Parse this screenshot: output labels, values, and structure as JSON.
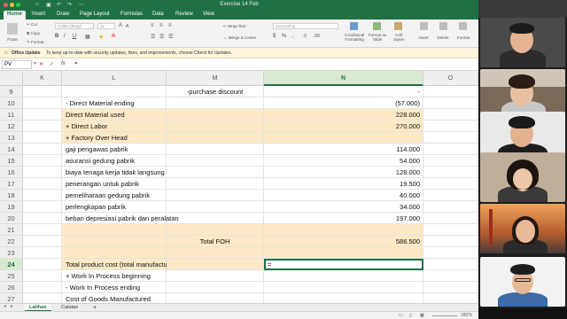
{
  "window": {
    "title": "Exercise 14 Feb"
  },
  "ribbon_tabs": [
    {
      "label": "Home",
      "active": true
    },
    {
      "label": "Insert"
    },
    {
      "label": "Draw"
    },
    {
      "label": "Page Layout"
    },
    {
      "label": "Formulas"
    },
    {
      "label": "Data"
    },
    {
      "label": "Review"
    },
    {
      "label": "View"
    }
  ],
  "ribbon": {
    "paste": "Paste",
    "cut": "Cut",
    "copy": "Copy",
    "format": "Format",
    "font": "Calibri (Body)",
    "size": "12",
    "wrap_text": "Wrap Text",
    "merge_center": "Merge & Center",
    "number_format": "Accounting",
    "conditional_formatting": "Conditional Formatting",
    "format_as_table": "Format as Table",
    "cell_styles": "Cell Styles",
    "insert": "Insert",
    "delete": "Delete",
    "format_cells": "Format"
  },
  "notification": {
    "title": "Office Update",
    "message": "To keep up-to-date with security updates, fixes, and improvements, choose Check for Updates."
  },
  "formula_bar": {
    "name_box": "PV",
    "cancel": "✕",
    "enter": "✓",
    "fx": "fx",
    "value": "="
  },
  "columns": [
    "K",
    "L",
    "M",
    "N",
    "O"
  ],
  "selected_column": "N",
  "rows": [
    {
      "n": "9",
      "l": "",
      "m": "-purchase discount",
      "n_val": "-",
      "hl": false
    },
    {
      "n": "10",
      "l": "- Direct Material  ending",
      "m": "",
      "n_val": "(57.000)",
      "hl": false
    },
    {
      "n": "11",
      "l": "Direct Material used",
      "m": "",
      "n_val": "228.000",
      "hl": true
    },
    {
      "n": "12",
      "l": "+ Direct Labor",
      "m": "",
      "n_val": "270.000",
      "hl": true
    },
    {
      "n": "13",
      "l": "+ Factory Over Head",
      "m": "",
      "n_val": "",
      "hl": true
    },
    {
      "n": "14",
      "l": "gaji pengawas pabrik",
      "m": "",
      "n_val": "114.000",
      "hl": false
    },
    {
      "n": "15",
      "l": "asuransi gedung pabrik",
      "m": "",
      "n_val": "54.000",
      "hl": false
    },
    {
      "n": "16",
      "l": "biaya tenaga kerja tidak langsung",
      "m": "",
      "n_val": "128.000",
      "hl": false
    },
    {
      "n": "17",
      "l": "penerangan untuk pabrik",
      "m": "",
      "n_val": "19.500",
      "hl": false
    },
    {
      "n": "18",
      "l": "pemeliharaan gedung pabrik",
      "m": "",
      "n_val": "40.000",
      "hl": false
    },
    {
      "n": "19",
      "l": "perlengkapan pabrik",
      "m": "",
      "n_val": "34.000",
      "hl": false
    },
    {
      "n": "20",
      "l": "beban depresiasi pabrik dan peralatan",
      "m": "",
      "n_val": "197.000",
      "hl": false
    },
    {
      "n": "21",
      "l": "",
      "m": "",
      "n_val": "",
      "hl": true
    },
    {
      "n": "22",
      "l": "",
      "m": "Total FOH",
      "n_val": "586.500",
      "hl": true
    },
    {
      "n": "23",
      "l": "",
      "m": "",
      "n_val": "",
      "hl": true
    },
    {
      "n": "24",
      "l": "Total product cost (total manufacturing cost)",
      "m": "",
      "n_val": "=",
      "hl": true,
      "active": true
    },
    {
      "n": "25",
      "l": "+ Work In Process beginning",
      "m": "",
      "n_val": "",
      "hl": false
    },
    {
      "n": "26",
      "l": "- Work In Process ending",
      "m": "",
      "n_val": "",
      "hl": false
    },
    {
      "n": "27",
      "l": "Cost of Goods Manufactured",
      "m": "",
      "n_val": "",
      "hl": false
    }
  ],
  "sheets": [
    {
      "label": "Latihan",
      "active": true
    },
    {
      "label": "Catatan",
      "active": false
    }
  ],
  "add_sheet": "+",
  "status": {
    "zoom": "182%"
  },
  "colors": {
    "excel_green": "#1f7145",
    "highlight": "#fde9c5",
    "video_bg": "#1d1d1d"
  }
}
